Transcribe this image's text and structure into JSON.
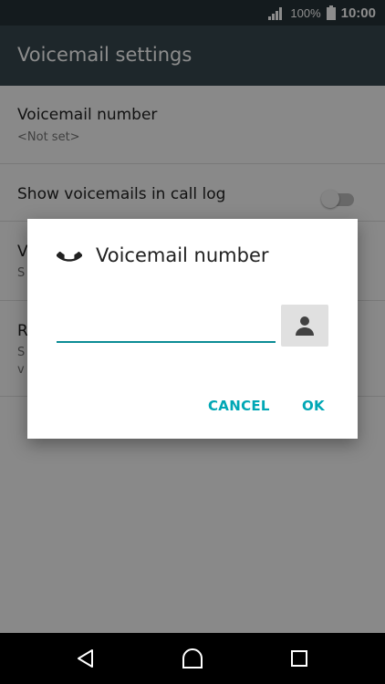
{
  "status_bar": {
    "battery_percent": "100%",
    "time": "10:00"
  },
  "app_bar": {
    "title": "Voicemail settings"
  },
  "settings": {
    "items": [
      {
        "primary": "Voicemail number",
        "secondary": "<Not set>"
      },
      {
        "primary": "Show voicemails in call log",
        "toggle_on": false
      },
      {
        "primary": "V",
        "secondary": "S"
      },
      {
        "primary": "R",
        "secondary": "S",
        "tertiary": "v"
      }
    ]
  },
  "dialog": {
    "title": "Voicemail number",
    "input_value": "",
    "cancel_label": "CANCEL",
    "ok_label": "OK",
    "icons": [
      "phone-icon",
      "contact-icon"
    ]
  },
  "navigation": {
    "icons": [
      "back-icon",
      "home-icon",
      "recents-icon"
    ]
  },
  "colors": {
    "accent": "#00a7b5",
    "app_bar": "#37474f",
    "status_bar": "#263238"
  }
}
